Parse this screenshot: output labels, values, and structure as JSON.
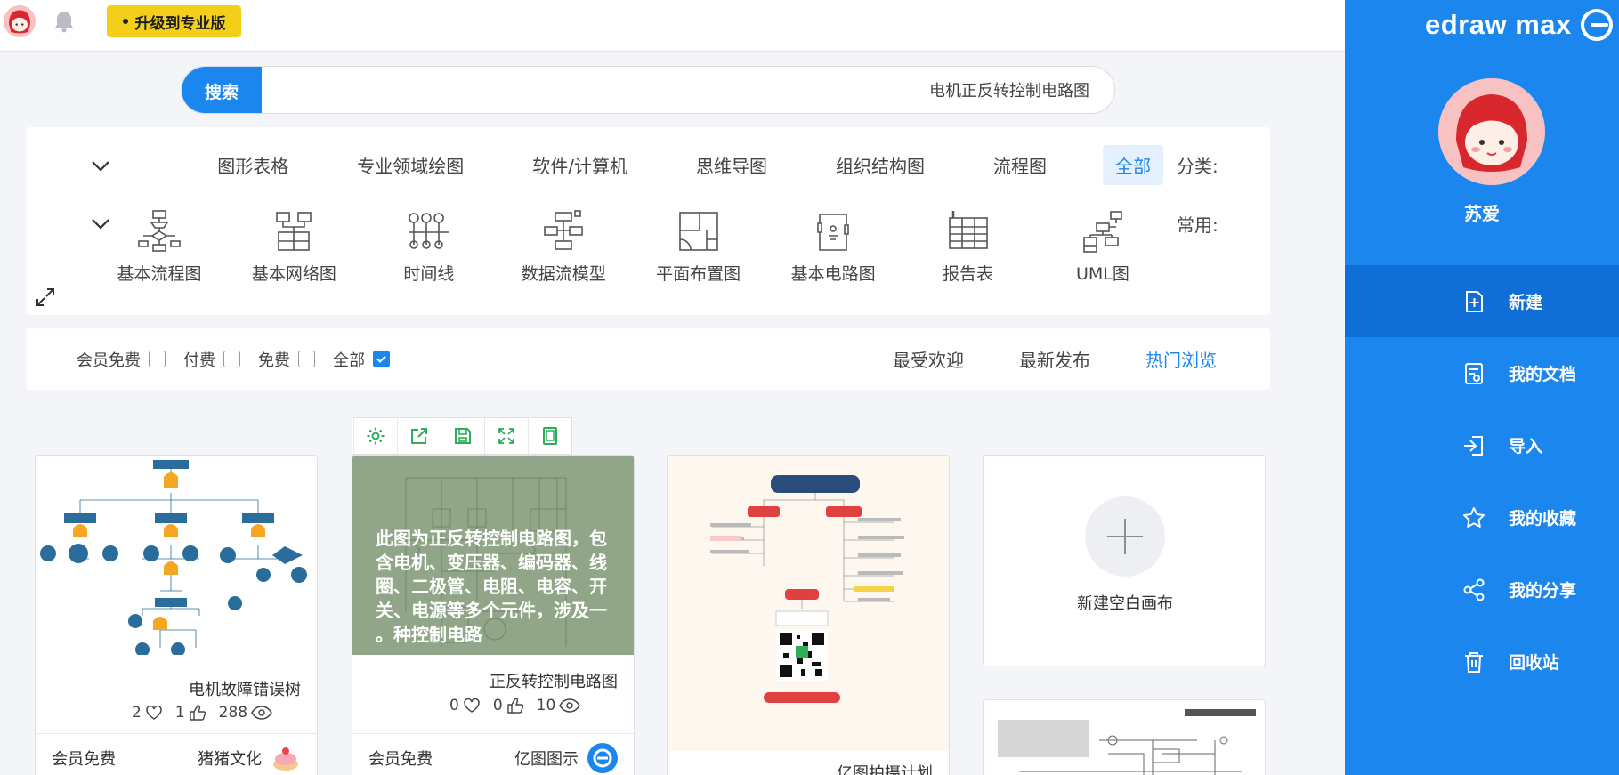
{
  "app": {
    "brand": "edraw max",
    "user_name": "苏爱",
    "upgrade_label": "升级到专业版"
  },
  "sidebar": {
    "items": [
      {
        "label": "新建",
        "icon": "new-file-icon",
        "active": true
      },
      {
        "label": "我的文档",
        "icon": "my-docs-icon"
      },
      {
        "label": "导入",
        "icon": "import-icon"
      },
      {
        "label": "我的收藏",
        "icon": "star-icon"
      },
      {
        "label": "我的分享",
        "icon": "share-icon"
      },
      {
        "label": "回收站",
        "icon": "trash-icon"
      }
    ]
  },
  "search": {
    "button_label": "搜索",
    "query": "电机正反转控制电路图"
  },
  "categories": {
    "label": "分类:",
    "items": [
      "全部",
      "流程图",
      "组织结构图",
      "思维导图",
      "软件/计算机",
      "专业领域绘图",
      "图形表格"
    ],
    "active": "全部"
  },
  "common": {
    "label": "常用:",
    "items": [
      "UML图",
      "报告表",
      "基本电路图",
      "平面布置图",
      "数据流模型",
      "时间线",
      "基本网络图",
      "基本流程图"
    ]
  },
  "sort": {
    "items": [
      "热门浏览",
      "最新发布",
      "最受欢迎"
    ],
    "active": "热门浏览"
  },
  "filters": [
    {
      "label": "全部",
      "checked": true
    },
    {
      "label": "免费",
      "checked": false
    },
    {
      "label": "付费",
      "checked": false
    },
    {
      "label": "会员免费",
      "checked": false
    }
  ],
  "cards": {
    "new_blank": {
      "label": "新建空白画布"
    },
    "mindmap": {
      "title": "亿图拍摄计划"
    },
    "circuit": {
      "title": "正反转控制电路图",
      "views": "10",
      "likes": "0",
      "favorites": "0",
      "author": "亿图图示",
      "price": "会员免费",
      "overlay": "此图为正反转控制电路图，包含电机、变压器、编码器、线圈、二极管、电阻、电容、开关、电源等多个元件，涉及一种控制电路。"
    },
    "fault_tree": {
      "title": "电机故障错误树",
      "views": "288",
      "likes": "1",
      "favorites": "2",
      "author": "猪猪文化",
      "price": "会员免费"
    }
  },
  "colors": {
    "accent": "#1c86ef",
    "sidebar_active": "#0f6fd6",
    "upgrade": "#f4cf19",
    "hover_overlay": "#7a9470"
  }
}
